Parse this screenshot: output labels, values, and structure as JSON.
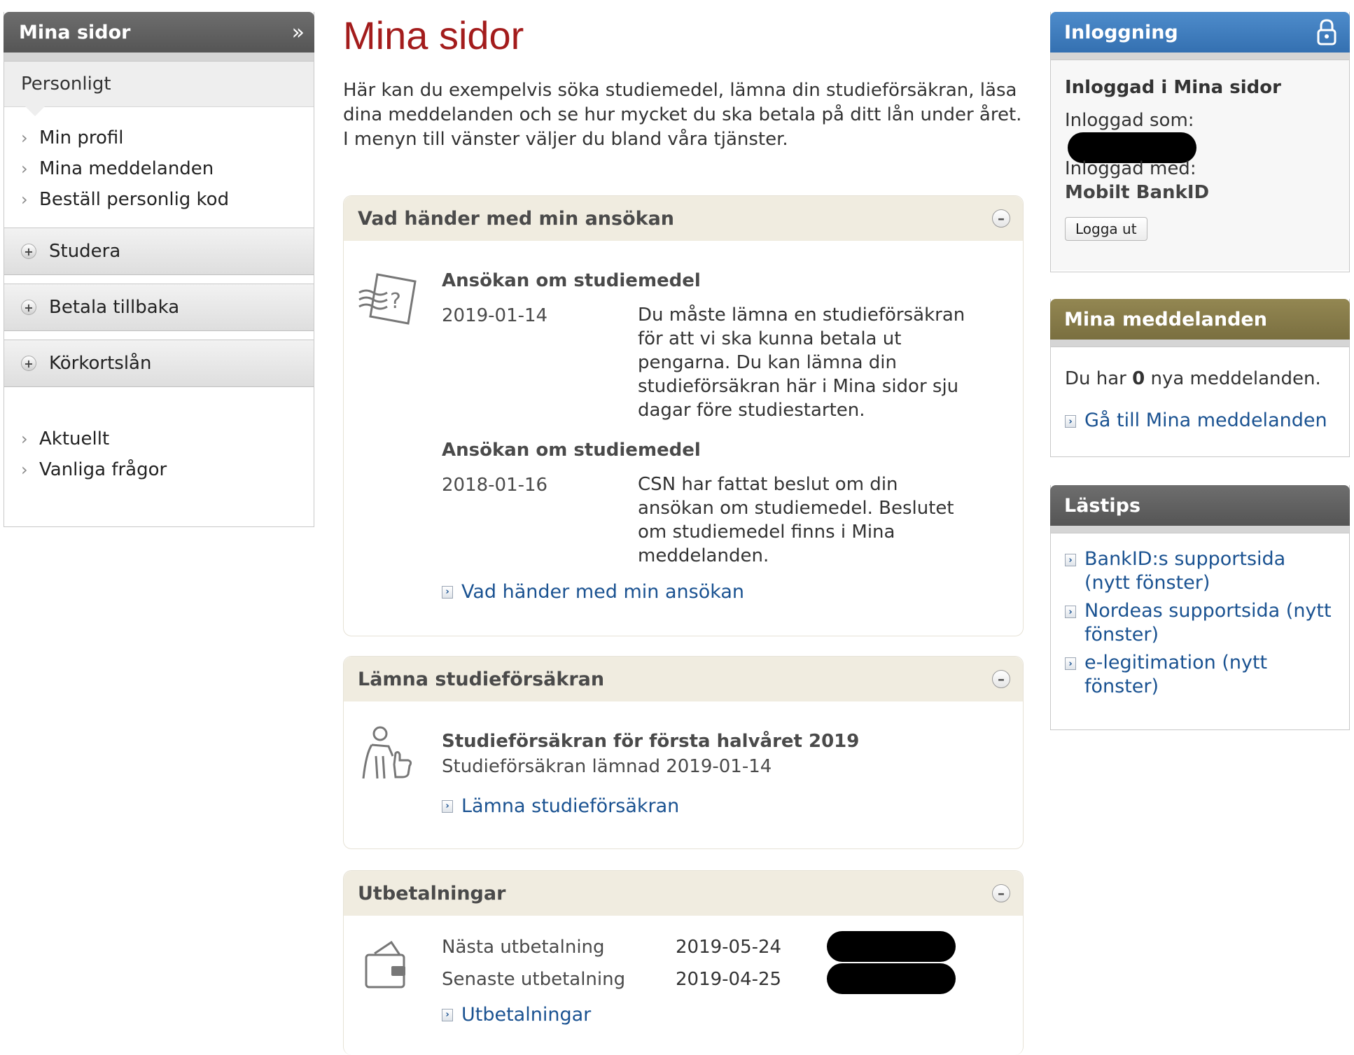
{
  "leftnav": {
    "title": "Mina sidor",
    "collapse_glyph": "»",
    "section": "Personligt",
    "items": [
      "Min profil",
      "Mina meddelanden",
      "Beställ personlig kod"
    ],
    "groups": [
      "Studera",
      "Betala tillbaka",
      "Körkortslån"
    ],
    "bottom_items": [
      "Aktuellt",
      "Vanliga frågor"
    ]
  },
  "main": {
    "title": "Mina sidor",
    "intro": "Här kan du exempelvis söka studiemedel, lämna din studieförsäkran, läsa dina meddelanden och se hur mycket du ska betala på ditt lån under året. I menyn till vänster väljer du bland våra tjänster.",
    "panels": {
      "application": {
        "heading": "Vad händer med min ansökan",
        "icon": "question-paper-icon",
        "entries": [
          {
            "title": "Ansökan om studiemedel",
            "date": "2019-01-14",
            "text": "Du måste lämna en studieförsäkran för att vi ska kunna betala ut pengarna. Du kan lämna din studieförsäkran här i Mina sidor sju dagar före studiestarten."
          },
          {
            "title": "Ansökan om studiemedel",
            "date": "2018-01-16",
            "text": "CSN har fattat beslut om din ansökan om studiemedel. Beslutet om studiemedel finns i Mina meddelanden."
          }
        ],
        "link": "Vad händer med min ansökan"
      },
      "insurance": {
        "heading": "Lämna studieförsäkran",
        "icon": "person-thumbs-up-icon",
        "title": "Studieförsäkran för första halvåret 2019",
        "status": "Studieförsäkran lämnad 2019-01-14",
        "link": "Lämna studieförsäkran"
      },
      "payments": {
        "heading": "Utbetalningar",
        "icon": "wallet-icon",
        "rows": [
          {
            "label": "Nästa utbetalning",
            "date": "2019-05-24"
          },
          {
            "label": "Senaste utbetalning",
            "date": "2019-04-25"
          }
        ],
        "link": "Utbetalningar"
      }
    }
  },
  "login": {
    "heading": "Inloggning",
    "icon": "padlock-icon",
    "title": "Inloggad i Mina sidor",
    "as_label": "Inloggad som:",
    "with_label": "Inloggad med:",
    "method": "Mobilt BankID",
    "logout": "Logga ut"
  },
  "messages": {
    "heading": "Mina meddelanden",
    "text_before": "Du har ",
    "count": "0",
    "text_after": " nya meddelanden.",
    "link": "Gå till Mina meddelanden"
  },
  "tips": {
    "heading": "Lästips",
    "links": [
      "BankID:s supportsida (nytt fönster)",
      "Nordeas supportsida (nytt fönster)",
      "e-legitimation (nytt fönster)"
    ]
  },
  "colors": {
    "title_red": "#a31c1c",
    "link_blue": "#1a5291",
    "login_blue": "#3d7cc0",
    "messages_olive": "#857a4a",
    "panel_beige": "#f0ece0",
    "nav_gray": "#5f5f5f"
  }
}
